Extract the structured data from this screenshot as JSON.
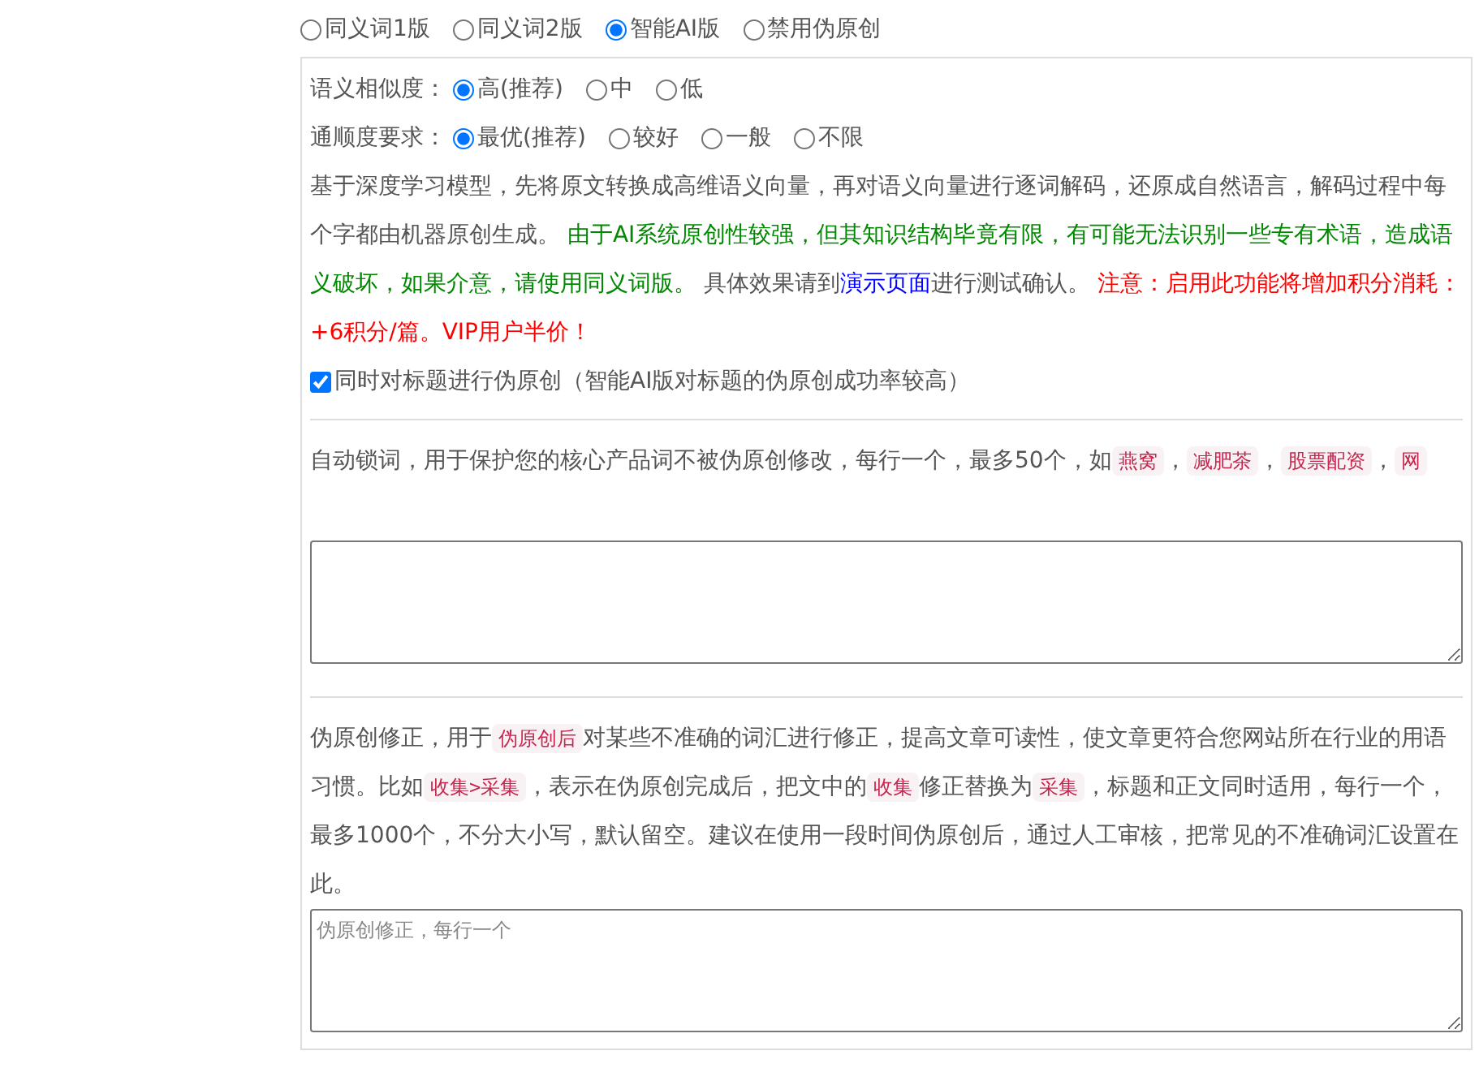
{
  "mode_options": [
    {
      "label": "同义词1版",
      "selected": false
    },
    {
      "label": "同义词2版",
      "selected": false
    },
    {
      "label": "智能AI版",
      "selected": true
    },
    {
      "label": "禁用伪原创",
      "selected": false
    }
  ],
  "similarity": {
    "label": "语义相似度：",
    "options": [
      {
        "label": "高(推荐)",
        "selected": true
      },
      {
        "label": "中",
        "selected": false
      },
      {
        "label": "低",
        "selected": false
      }
    ]
  },
  "fluency": {
    "label": "通顺度要求：",
    "options": [
      {
        "label": "最优(推荐)",
        "selected": true
      },
      {
        "label": "较好",
        "selected": false
      },
      {
        "label": "一般",
        "selected": false
      },
      {
        "label": "不限",
        "selected": false
      }
    ]
  },
  "ai_description": [
    {
      "kind": "text",
      "text": "基于深度学习模型，先将原文转换成高维语义向量，再对语义向量进行逐词解码，还原成自然语言，解码过程中每个字都由机器原创生成。 "
    },
    {
      "kind": "green",
      "text": "由于AI系统原创性较强，但其知识结构毕竟有限，有可能无法识别一些专有术语，造成语义破坏，如果介意，请使用同义词版。"
    },
    {
      "kind": "text",
      "text": " 具体效果请到"
    },
    {
      "kind": "link",
      "text": "演示页面"
    },
    {
      "kind": "text",
      "text": "进行测试确认。 "
    },
    {
      "kind": "red",
      "text": "注意：启用此功能将增加积分消耗：+6积分/篇。VIP用户半价！"
    }
  ],
  "title_checkbox": {
    "label": "同时对标题进行伪原创（智能AI版对标题的伪原创成功率较高）",
    "checked": true
  },
  "lock_words": {
    "description": [
      {
        "kind": "text",
        "text": "自动锁词，用于保护您的核心产品词不被伪原创修改，每行一个，最多50个，如"
      },
      {
        "kind": "code",
        "text": "燕窝"
      },
      {
        "kind": "text",
        "text": "，"
      },
      {
        "kind": "code",
        "text": "减肥茶"
      },
      {
        "kind": "text",
        "text": "，"
      },
      {
        "kind": "code",
        "text": "股票配资"
      },
      {
        "kind": "text",
        "text": "，"
      },
      {
        "kind": "code",
        "text": "网"
      }
    ]
  },
  "correction": {
    "description": [
      {
        "kind": "text",
        "text": "伪原创修正，用于"
      },
      {
        "kind": "code",
        "text": "伪原创后"
      },
      {
        "kind": "text",
        "text": "对某些不准确的词汇进行修正，提高文章可读性，使文章更符合您网站所在行业的用语习惯。比如"
      },
      {
        "kind": "code",
        "text": "收集>采集"
      },
      {
        "kind": "text",
        "text": "，表示在伪原创完成后，把文中的"
      },
      {
        "kind": "code",
        "text": "收集"
      },
      {
        "kind": "text",
        "text": "修正替换为"
      },
      {
        "kind": "code",
        "text": "采集"
      },
      {
        "kind": "text",
        "text": "，标题和正文同时适用，每行一个，最多1000个，不分大小写，默认留空。建议在使用一段时间伪原创后，通过人工审核，把常见的不准确词汇设置在此。"
      }
    ],
    "textarea": {
      "placeholder": "伪原创修正，每行一个"
    }
  }
}
